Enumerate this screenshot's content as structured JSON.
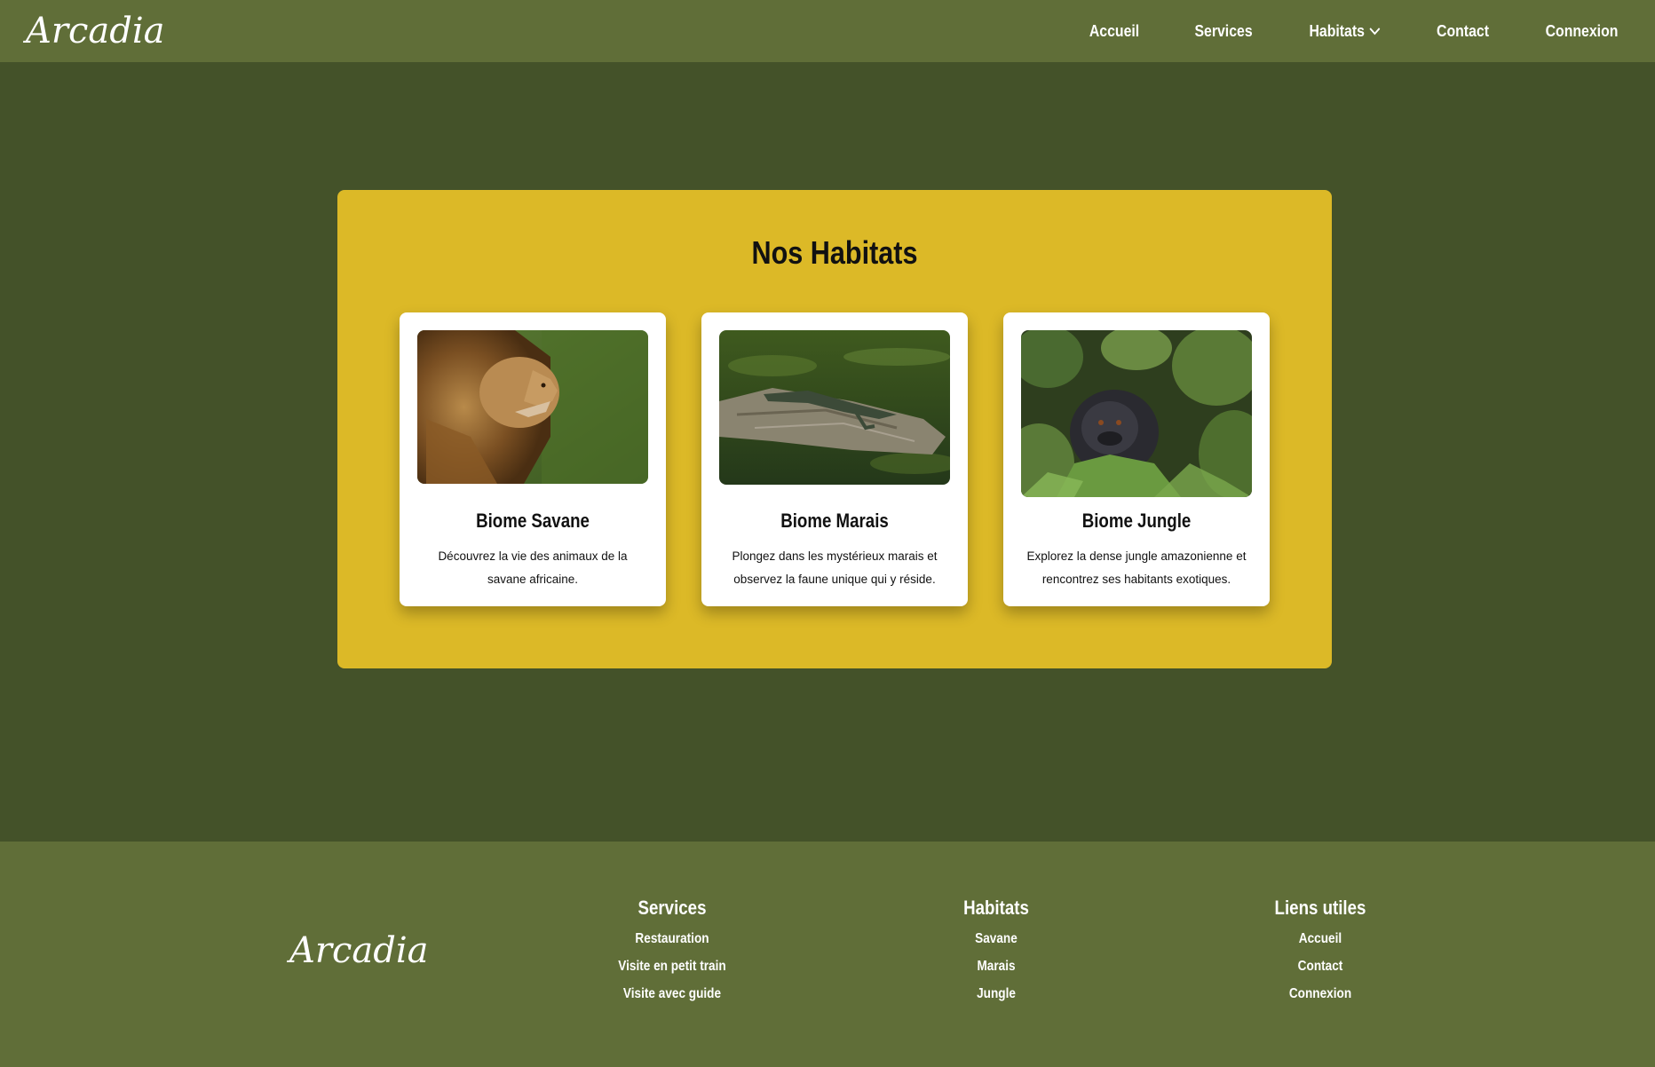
{
  "header": {
    "logo": "Arcadia",
    "nav": [
      {
        "label": "Accueil"
      },
      {
        "label": "Services"
      },
      {
        "label": "Habitats",
        "has_dropdown": true
      },
      {
        "label": "Contact"
      },
      {
        "label": "Connexion"
      }
    ]
  },
  "main": {
    "title": "Nos Habitats",
    "cards": [
      {
        "title": "Biome Savane",
        "text": "Découvrez la vie des animaux de la savane africaine.",
        "image_icon": "lion-photo"
      },
      {
        "title": "Biome Marais",
        "text": "Plongez dans les mystérieux marais et observez la faune unique qui y réside.",
        "image_icon": "alligator-photo"
      },
      {
        "title": "Biome Jungle",
        "text": "Explorez la dense jungle amazonienne et rencontrez ses habitants exotiques.",
        "image_icon": "gorilla-photo"
      }
    ]
  },
  "footer": {
    "logo": "Arcadia",
    "columns": [
      {
        "title": "Services",
        "links": [
          "Restauration",
          "Visite en petit train",
          "Visite avec guide"
        ]
      },
      {
        "title": "Habitats",
        "links": [
          "Savane",
          "Marais",
          "Jungle"
        ]
      },
      {
        "title": "Liens utiles",
        "links": [
          "Accueil",
          "Contact",
          "Connexion"
        ]
      }
    ]
  },
  "colors": {
    "header_bg": "#606e38",
    "main_bg": "#445229",
    "panel_bg": "#dcb927",
    "card_bg": "#ffffff"
  }
}
